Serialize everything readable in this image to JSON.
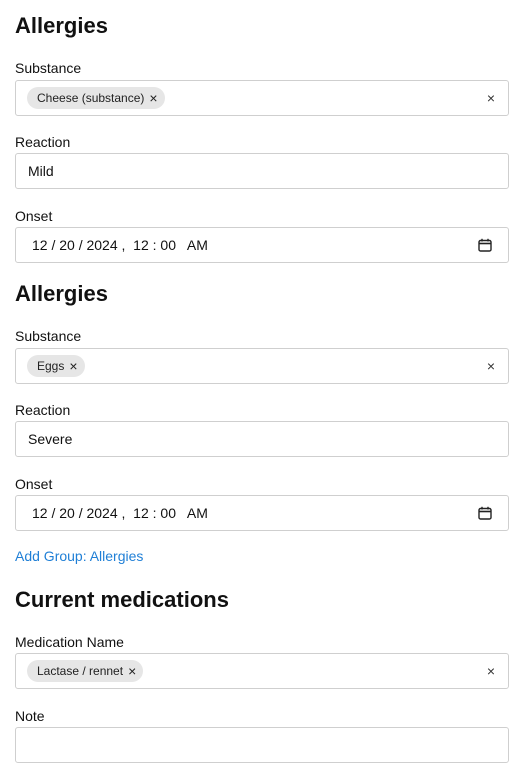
{
  "groups": [
    {
      "title": "Allergies",
      "substance_label": "Substance",
      "substance_chip": "Cheese (substance)",
      "reaction_label": "Reaction",
      "reaction_value": "Mild",
      "onset_label": "Onset",
      "onset_value": "12 / 20 / 2024 ,  12 : 00   AM"
    },
    {
      "title": "Allergies",
      "substance_label": "Substance",
      "substance_chip": "Eggs",
      "reaction_label": "Reaction",
      "reaction_value": "Severe",
      "onset_label": "Onset",
      "onset_value": "12 / 20 / 2024 ,  12 : 00   AM"
    }
  ],
  "add_group_link": "Add Group: Allergies",
  "medications": {
    "title": "Current medications",
    "name_label": "Medication Name",
    "name_chip": "Lactase / rennet",
    "note_label": "Note",
    "note_value": ""
  },
  "icons": {
    "chip_remove": "×",
    "clear": "×",
    "calendar": "calendar-icon"
  },
  "colors": {
    "link": "#1f7fd6",
    "chip_bg": "#e6e6e6",
    "border": "#cfcfcf"
  }
}
